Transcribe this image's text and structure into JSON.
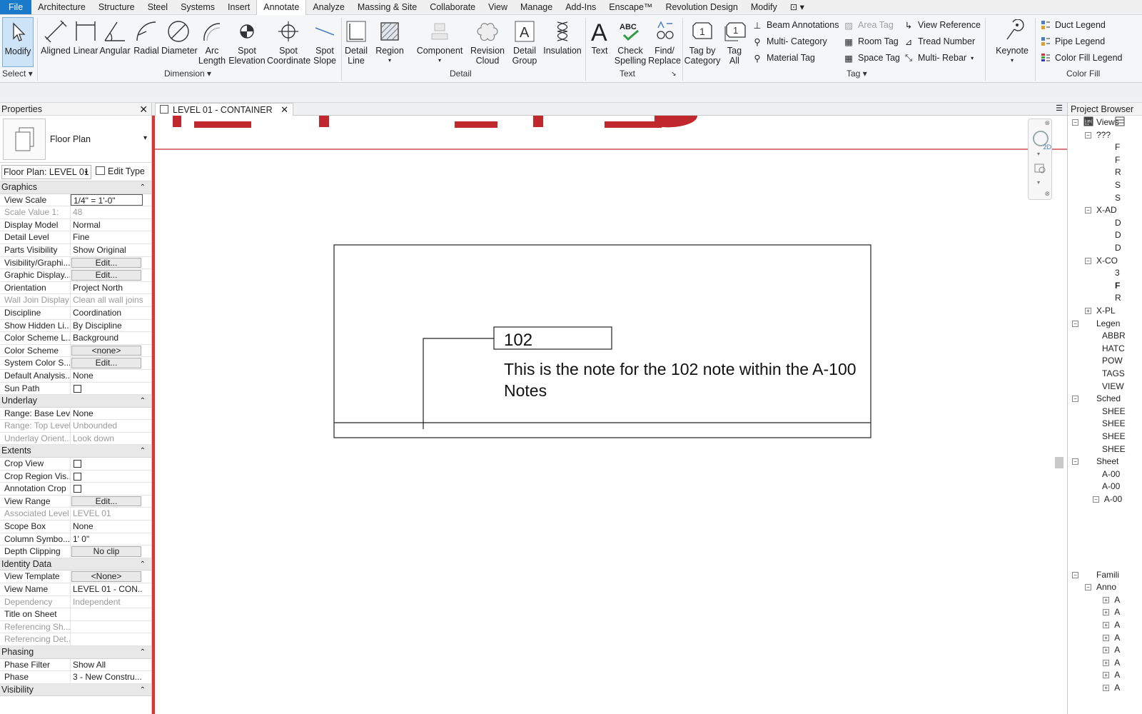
{
  "menu": {
    "file": "File",
    "tabs": [
      "Architecture",
      "Structure",
      "Steel",
      "Systems",
      "Insert",
      "Annotate",
      "Analyze",
      "Massing & Site",
      "Collaborate",
      "View",
      "Manage",
      "Add-Ins",
      "Enscape™",
      "Revolution Design",
      "Modify"
    ],
    "active": "Annotate"
  },
  "ribbon": {
    "select": {
      "modify": "Modify",
      "panel": "Select"
    },
    "dimension": {
      "aligned": "Aligned",
      "linear": "Linear",
      "angular": "Angular",
      "radial": "Radial",
      "diameter": "Diameter",
      "arc_length_1": "Arc",
      "arc_length_2": "Length",
      "spot_elev_1": "Spot",
      "spot_elev_2": "Elevation",
      "spot_coord_1": "Spot",
      "spot_coord_2": "Coordinate",
      "spot_slope_1": "Spot",
      "spot_slope_2": "Slope",
      "panel": "Dimension"
    },
    "detail": {
      "detail_line_1": "Detail",
      "detail_line_2": "Line",
      "region": "Region",
      "component": "Component",
      "revision_1": "Revision",
      "revision_2": "Cloud",
      "detail_group_1": "Detail",
      "detail_group_2": "Group",
      "insulation": "Insulation",
      "panel": "Detail"
    },
    "text": {
      "text": "Text",
      "check_1": "Check",
      "check_2": "Spelling",
      "find_1": "Find/",
      "find_2": "Replace",
      "abc": "ABC",
      "panel": "Text"
    },
    "tag": {
      "by_cat_1": "Tag by",
      "by_cat_2": "Category",
      "tag_all_1": "Tag",
      "tag_all_2": "All",
      "beam": "Beam  Annotations",
      "multi_cat": "Multi- Category",
      "material": "Material  Tag",
      "area": "Area  Tag",
      "room": "Room  Tag",
      "space": "Space  Tag",
      "view_ref": "View  Reference",
      "tread": "Tread  Number",
      "rebar": "Multi- Rebar",
      "badge": "1",
      "panel": "Tag"
    },
    "keynote": "Keynote",
    "color_fill": {
      "duct": "Duct  Legend",
      "pipe": "Pipe  Legend",
      "color": "Color Fill  Legend",
      "panel": "Color Fill"
    }
  },
  "properties": {
    "title": "Properties",
    "type_name": "Floor Plan",
    "instance": "Floor Plan: LEVEL 01",
    "edit_type": "Edit Type",
    "groups": [
      {
        "name": "Graphics",
        "rows": [
          {
            "n": "View Scale",
            "v": "1/4\" = 1'-0\"",
            "style": "box"
          },
          {
            "n": "Scale Value    1:",
            "v": "48",
            "style": "dim"
          },
          {
            "n": "Display Model",
            "v": "Normal"
          },
          {
            "n": "Detail Level",
            "v": "Fine"
          },
          {
            "n": "Parts Visibility",
            "v": "Show Original"
          },
          {
            "n": "Visibility/Graphi...",
            "v": "Edit...",
            "style": "btn"
          },
          {
            "n": "Graphic Display...",
            "v": "Edit...",
            "style": "btn"
          },
          {
            "n": "Orientation",
            "v": "Project North"
          },
          {
            "n": "Wall Join Display",
            "v": "Clean all wall joins",
            "style": "dim"
          },
          {
            "n": "Discipline",
            "v": "Coordination"
          },
          {
            "n": "Show Hidden Li...",
            "v": "By Discipline"
          },
          {
            "n": "Color Scheme L...",
            "v": "Background"
          },
          {
            "n": "Color Scheme",
            "v": "<none>",
            "style": "btn"
          },
          {
            "n": "System Color S...",
            "v": "Edit...",
            "style": "btn"
          },
          {
            "n": "Default Analysis...",
            "v": "None"
          },
          {
            "n": "Sun Path",
            "v": "",
            "style": "chk"
          }
        ]
      },
      {
        "name": "Underlay",
        "rows": [
          {
            "n": "Range: Base Level",
            "v": "None"
          },
          {
            "n": "Range: Top Level",
            "v": "Unbounded",
            "style": "dim"
          },
          {
            "n": "Underlay Orient...",
            "v": "Look down",
            "style": "dim"
          }
        ]
      },
      {
        "name": "Extents",
        "rows": [
          {
            "n": "Crop View",
            "v": "",
            "style": "chk"
          },
          {
            "n": "Crop Region Vis...",
            "v": "",
            "style": "chk"
          },
          {
            "n": "Annotation Crop",
            "v": "",
            "style": "chk"
          },
          {
            "n": "View Range",
            "v": "Edit...",
            "style": "btn"
          },
          {
            "n": "Associated Level",
            "v": "LEVEL 01",
            "style": "dim"
          },
          {
            "n": "Scope Box",
            "v": "None"
          },
          {
            "n": "Column Symbo...",
            "v": "1'  0\""
          },
          {
            "n": "Depth Clipping",
            "v": "No clip",
            "style": "btn"
          }
        ]
      },
      {
        "name": "Identity Data",
        "rows": [
          {
            "n": "View Template",
            "v": "<None>",
            "style": "btn"
          },
          {
            "n": "View Name",
            "v": "LEVEL 01 - CON..."
          },
          {
            "n": "Dependency",
            "v": "Independent",
            "style": "dim"
          },
          {
            "n": "Title on Sheet",
            "v": ""
          },
          {
            "n": "Referencing Sh...",
            "v": "",
            "style": "dim"
          },
          {
            "n": "Referencing Det...",
            "v": "",
            "style": "dim"
          }
        ]
      },
      {
        "name": "Phasing",
        "rows": [
          {
            "n": "Phase Filter",
            "v": "Show All"
          },
          {
            "n": "Phase",
            "v": "3 - New Constru..."
          }
        ]
      },
      {
        "name": "Visibility",
        "rows": []
      }
    ]
  },
  "view": {
    "tab_label": "LEVEL 01 - CONTAINER",
    "note_number": "102",
    "note_line1": "This is the note for the 102 note within the A-100",
    "note_line2": "Notes",
    "accent_color": "#e03333"
  },
  "browser": {
    "title": "Project Browser",
    "rows": [
      {
        "t": "Views",
        "lvl": 0,
        "exp": "−",
        "icon": "views"
      },
      {
        "t": "???",
        "lvl": 1,
        "exp": "−"
      },
      {
        "t": "F",
        "lvl": 3
      },
      {
        "t": "F",
        "lvl": 3
      },
      {
        "t": "R",
        "lvl": 3
      },
      {
        "t": "S",
        "lvl": 3
      },
      {
        "t": "S",
        "lvl": 3
      },
      {
        "t": "X-AD",
        "lvl": 1,
        "exp": "−"
      },
      {
        "t": "D",
        "lvl": 3
      },
      {
        "t": "D",
        "lvl": 3
      },
      {
        "t": "D",
        "lvl": 3
      },
      {
        "t": "X-CO",
        "lvl": 1,
        "exp": "−"
      },
      {
        "t": "3",
        "lvl": 3
      },
      {
        "t": "F",
        "lvl": 3,
        "bold": true
      },
      {
        "t": "R",
        "lvl": 3
      },
      {
        "t": "X-PL",
        "lvl": 1,
        "exp": "+"
      },
      {
        "t": "Legen",
        "lvl": 0,
        "exp": "−",
        "icon": "legend"
      },
      {
        "t": "ABBR",
        "lvl": 2
      },
      {
        "t": "HATC",
        "lvl": 2
      },
      {
        "t": "POW",
        "lvl": 2
      },
      {
        "t": "TAGS",
        "lvl": 2
      },
      {
        "t": "VIEW",
        "lvl": 2
      },
      {
        "t": "Sched",
        "lvl": 0,
        "exp": "−",
        "icon": "schedule"
      },
      {
        "t": "SHEE",
        "lvl": 2
      },
      {
        "t": "SHEE",
        "lvl": 2
      },
      {
        "t": "SHEE",
        "lvl": 2
      },
      {
        "t": "SHEE",
        "lvl": 2
      },
      {
        "t": "Sheet",
        "lvl": 0,
        "exp": "−",
        "icon": "sheet"
      },
      {
        "t": "A-00",
        "lvl": 2
      },
      {
        "t": "A-00",
        "lvl": 2
      },
      {
        "t": "A-00",
        "lvl": 1.6,
        "exp": "−"
      },
      {
        "t": "",
        "lvl": 3,
        "icon": "subsheet"
      },
      {
        "t": "",
        "lvl": 3,
        "icon": "subsheet"
      },
      {
        "t": "",
        "lvl": 3,
        "icon": "subsheet"
      },
      {
        "t": "",
        "lvl": 3,
        "icon": "subsheet"
      },
      {
        "t": "",
        "lvl": 3,
        "icon": "subsheet"
      },
      {
        "t": "Famili",
        "lvl": 0,
        "exp": "−",
        "icon": "family"
      },
      {
        "t": "Anno",
        "lvl": 1,
        "exp": "−"
      },
      {
        "t": "A",
        "lvl": 2.4,
        "exp": "+"
      },
      {
        "t": "A",
        "lvl": 2.4,
        "exp": "+"
      },
      {
        "t": "A",
        "lvl": 2.4,
        "exp": "+"
      },
      {
        "t": "A",
        "lvl": 2.4,
        "exp": "+"
      },
      {
        "t": "A",
        "lvl": 2.4,
        "exp": "+"
      },
      {
        "t": "A",
        "lvl": 2.4,
        "exp": "+"
      },
      {
        "t": "A",
        "lvl": 2.4,
        "exp": "+"
      },
      {
        "t": "A",
        "lvl": 2.4,
        "exp": "+"
      }
    ]
  }
}
